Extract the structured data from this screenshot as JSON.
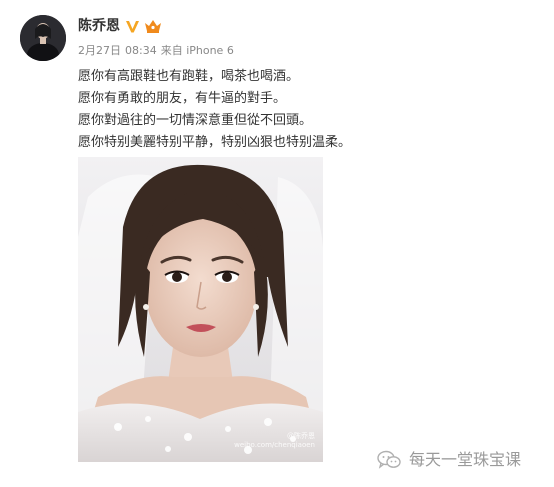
{
  "post": {
    "author": {
      "name": "陈乔恩",
      "verified_badge": "V",
      "member_badge": "vip-crown-icon"
    },
    "meta": {
      "date": "2月27日",
      "time": "08:34",
      "source": "来自 iPhone 6"
    },
    "text_lines": [
      "愿你有高跟鞋也有跑鞋，喝茶也喝酒。",
      "愿你有勇敢的朋友，有牛逼的對手。",
      "愿你對過往的一切情深意重但從不回頭。",
      "愿你特别美麗特别平静，特别凶狠也特别温柔。"
    ],
    "photo": {
      "watermark_line1": "@陈乔恩",
      "watermark_line2": "weibo.com/chenqiaoen"
    }
  },
  "channel": {
    "name": "每天一堂珠宝课",
    "icon": "wechat-icon"
  },
  "colors": {
    "verified": "#f5a623",
    "member": "#f08a1c",
    "meta_text": "#888888",
    "body_text": "#333333",
    "channel_text": "#9a9a9a"
  }
}
